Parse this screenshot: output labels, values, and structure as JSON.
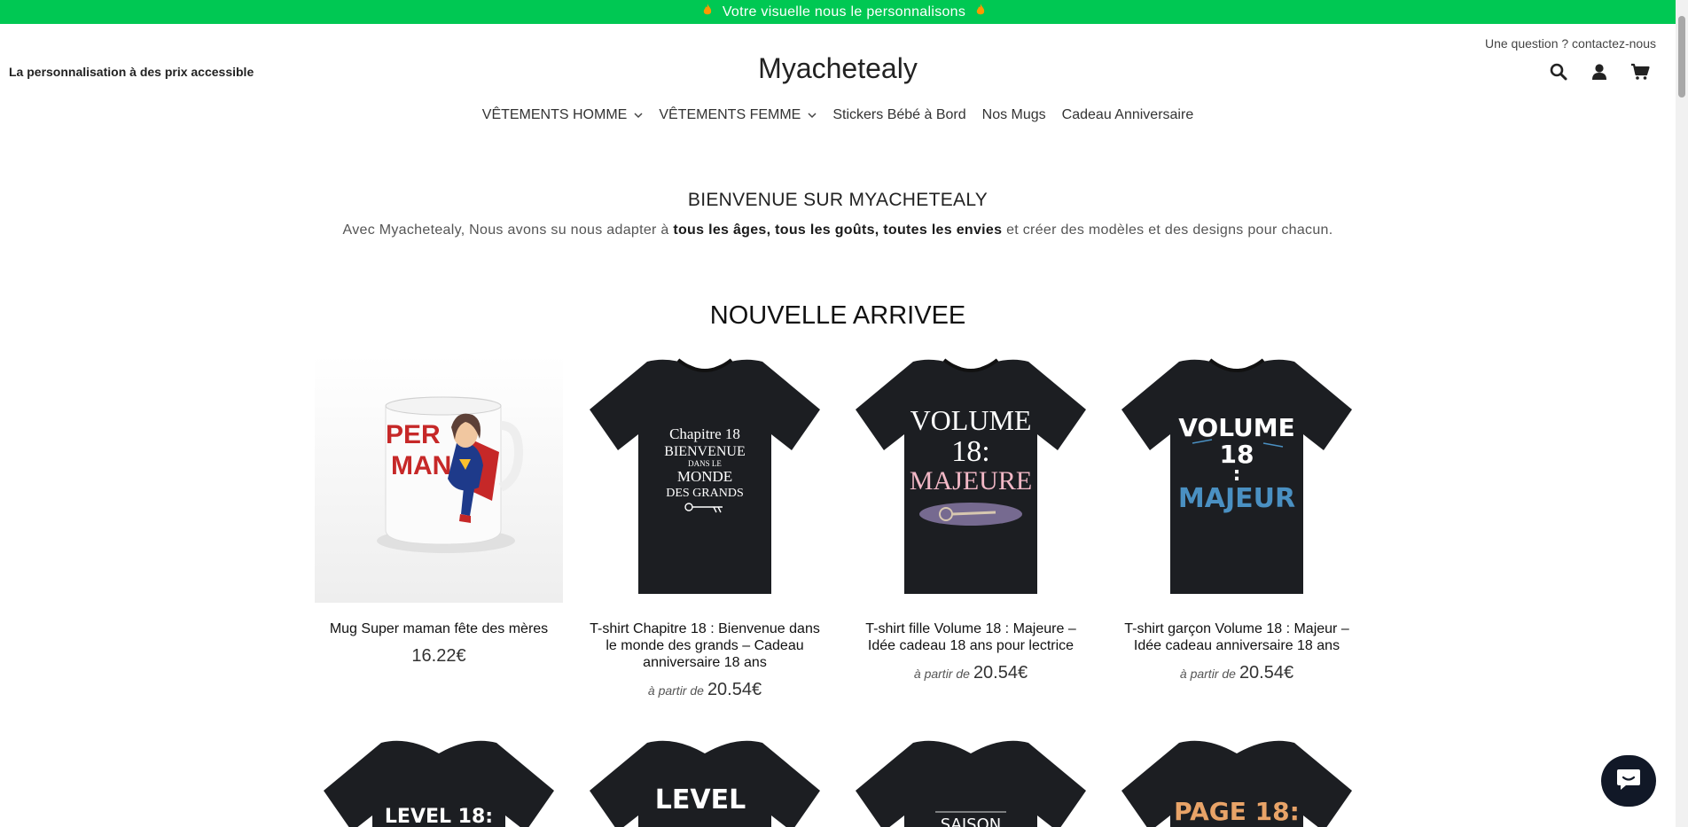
{
  "announcement": {
    "text": "Votre visuelle nous le personnalisons",
    "icon": "fire-icon"
  },
  "header": {
    "tagline": "La personnalisation à des prix accessible",
    "contact": "Une question ? contactez-nous",
    "logo": "Myachetealy",
    "icons": [
      "search-icon",
      "user-icon",
      "cart-icon"
    ]
  },
  "nav": {
    "items": [
      {
        "label": "VÊTEMENTS HOMME",
        "dropdown": true
      },
      {
        "label": "VÊTEMENTS FEMME",
        "dropdown": true
      },
      {
        "label": "Stickers Bébé à Bord",
        "dropdown": false
      },
      {
        "label": "Nos Mugs",
        "dropdown": false
      },
      {
        "label": "Cadeau Anniversaire",
        "dropdown": false
      }
    ]
  },
  "welcome": {
    "title": "BIENVENUE SUR MYACHETEALY",
    "text_before": "Avec Myachetealy, Nous avons su nous adapter à ",
    "text_bold": "tous les âges, tous les goûts, toutes les envies",
    "text_after": " et créer des modèles et des designs pour chacun."
  },
  "section": {
    "title": "NOUVELLE ARRIVEE"
  },
  "products": [
    {
      "name": "Mug Super maman fête des mères",
      "price": "16.22€",
      "from": "",
      "image_text": [
        "PER",
        "MAN"
      ]
    },
    {
      "name": "T-shirt Chapitre 18 : Bienvenue dans le monde des grands – Cadeau anniversaire 18 ans",
      "price": "20.54€",
      "from": "à partir de",
      "image_text": [
        "Chapitre 18",
        "BIENVENUE",
        "DANS LE",
        "MONDE",
        "DES GRANDS"
      ]
    },
    {
      "name": "T-shirt fille Volume 18 : Majeure – Idée cadeau 18 ans pour lectrice",
      "price": "20.54€",
      "from": "à partir de",
      "image_text": [
        "VOLUME",
        "18:",
        "MAJEURE"
      ]
    },
    {
      "name": "T-shirt garçon Volume 18 : Majeur – Idée cadeau anniversaire 18 ans",
      "price": "20.54€",
      "from": "à partir de",
      "image_text": [
        "VOLUME",
        "18",
        ":",
        "MAJEUR"
      ]
    }
  ],
  "products_row2": [
    {
      "image_text": "LEVEL 18:"
    },
    {
      "image_text": "LEVEL"
    },
    {
      "image_text": "SAISON"
    },
    {
      "image_text": "PAGE 18:"
    }
  ],
  "colors": {
    "announcement": "#00c853",
    "shirt": "#1c1e22",
    "chat": "#111827"
  }
}
